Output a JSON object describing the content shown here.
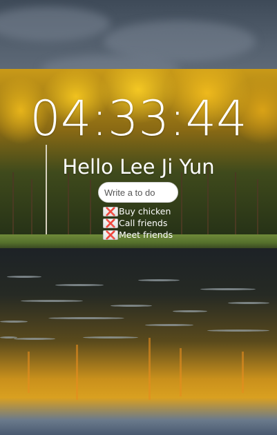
{
  "clock": {
    "time": "04:33:44"
  },
  "greeting": {
    "text": "Hello Lee Ji Yun"
  },
  "todo_form": {
    "placeholder": "Write a to do"
  },
  "todos": [
    {
      "label": "Buy chicken",
      "delete_label": "❌"
    },
    {
      "label": "Call friends",
      "delete_label": "❌"
    },
    {
      "label": "Meet friends",
      "delete_label": "❌"
    }
  ],
  "icons": {
    "delete": "close-icon"
  },
  "colors": {
    "text": "#ffffff",
    "delete_mark": "#c62828",
    "input_bg": "#ffffff"
  }
}
